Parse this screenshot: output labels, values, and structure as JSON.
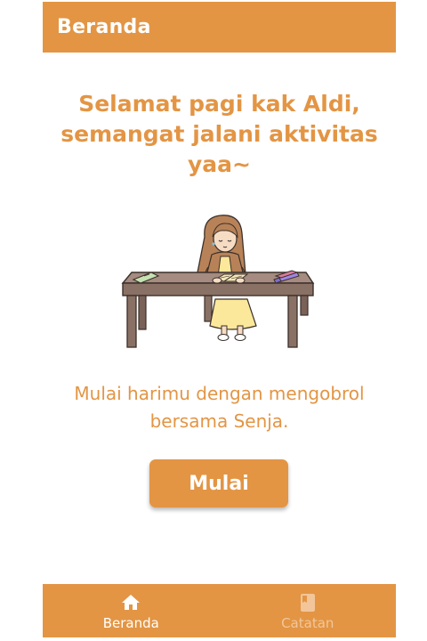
{
  "header": {
    "title": "Beranda"
  },
  "main": {
    "greeting_line1": "Selamat pagi kak Aldi,",
    "greeting_line2": "semangat jalani aktivitas",
    "greeting_line3": "yaa~",
    "subtitle_line1": "Mulai harimu dengan mengobrol",
    "subtitle_line2": "bersama Senja.",
    "start_button_label": "Mulai"
  },
  "bottom_nav": {
    "items": [
      {
        "label": "Beranda",
        "icon": "home-icon",
        "active": true
      },
      {
        "label": "Catatan",
        "icon": "notebook-icon",
        "active": false
      }
    ]
  },
  "colors": {
    "primary": "#e39544",
    "on_primary": "#ffffff",
    "inactive_nav": "#f2c69a",
    "background": "#ffffff"
  }
}
